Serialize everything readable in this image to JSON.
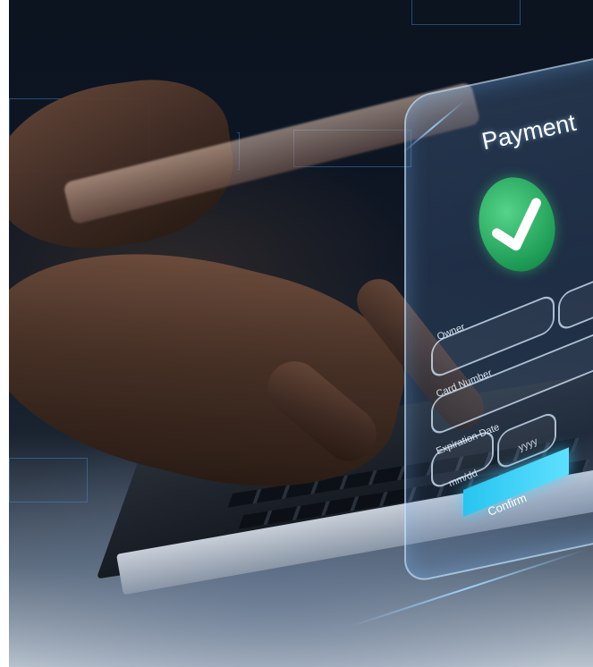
{
  "payment_card": {
    "title": "Payment",
    "success_icon": "check-circle-icon",
    "fields": {
      "owner_label": "Owner",
      "card_number_label": "Card Number",
      "expiration_label": "Expiration Date",
      "month_day_placeholder": "mm/dd",
      "year_placeholder": "yyyy"
    },
    "confirm_label": "Confirm"
  },
  "colors": {
    "accent_cyan": "#3fd2f7",
    "success_green": "#2bb36a",
    "glow_blue": "#9fd4ff"
  }
}
